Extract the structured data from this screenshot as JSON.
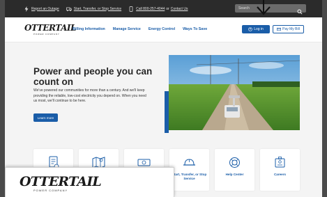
{
  "utility": {
    "report_outage": "Report an Outage",
    "start_transfer_stop": "Start, Transfer, or Stop Service",
    "call_prefix": "Call 800-257-4044",
    "or": "or",
    "contact_us": "Contact Us",
    "search_placeholder": "Search"
  },
  "logo": {
    "wordmark": "OTTERTAIL",
    "tagline": "POWER COMPANY"
  },
  "nav": {
    "items": [
      "Billing Information",
      "Manage Service",
      "Energy Control",
      "Ways To Save"
    ],
    "login": "Log in",
    "pay": "Pay My Bill"
  },
  "hero": {
    "title": "Power and people you can count on",
    "body": "We've powered our communities for more than a century. And we'll keep providing the reliable, low-cost electricity you depend on. When you need us most, we'll continue to be here.",
    "button": "Learn more"
  },
  "cards": [
    {
      "label": "",
      "icon": "document-icon"
    },
    {
      "label": "",
      "icon": "map-icon"
    },
    {
      "label": "",
      "icon": "money-icon"
    },
    {
      "label": "Start, Transfer, or Stop Service",
      "icon": "hard-hat-icon"
    },
    {
      "label": "Help Center",
      "icon": "lifebuoy-icon"
    },
    {
      "label": "Careers",
      "icon": "id-badge-icon"
    }
  ],
  "colors": {
    "brand_blue": "#1a5da8",
    "utility_bar": "#2b2b2b",
    "hero_bg": "#f4f4f4"
  }
}
